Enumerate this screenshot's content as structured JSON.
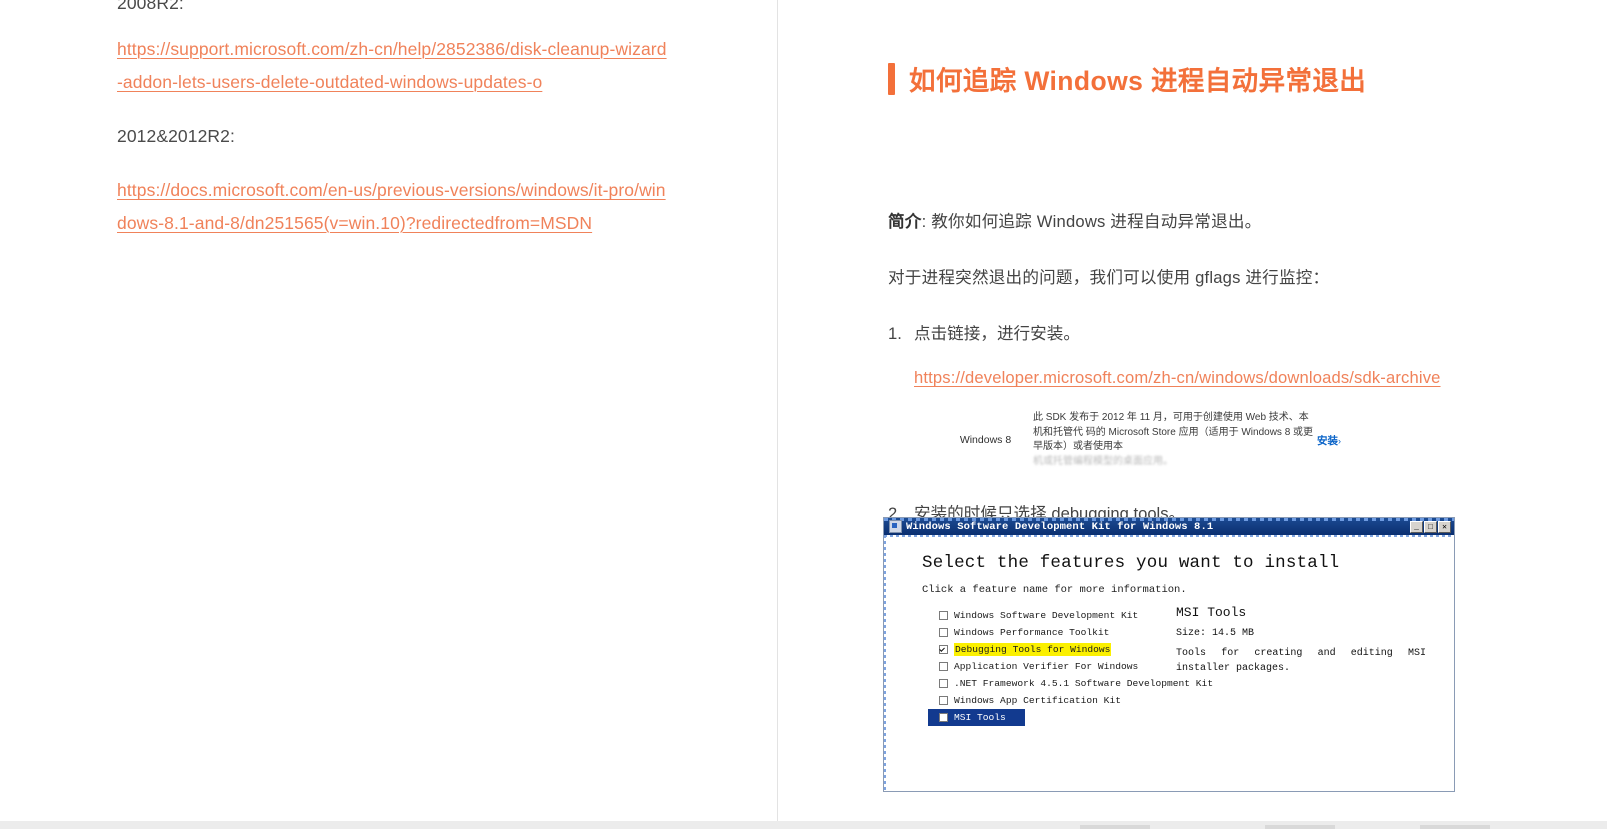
{
  "left_column": {
    "partial_top_text": "2008R2:",
    "link_1": "https://support.microsoft.com/zh-cn/help/2852386/disk-cleanup-wizard-addon-lets-users-delete-outdated-windows-updates-o",
    "label_2012": "2012&2012R2:",
    "link_2": "https://docs.microsoft.com/en-us/previous-versions/windows/it-pro/windows-8.1-and-8/dn251565(v=win.10)?redirectedfrom=MSDN"
  },
  "right_column": {
    "title": "如何追踪 Windows 进程自动异常退出",
    "intro_label": "简介",
    "intro_text": ": 教你如何追踪 Windows 进程自动异常退出。",
    "second_para": "对于进程突然退出的问题，我们可以使用 gflags 进行监控：",
    "steps": [
      {
        "num": "1.",
        "text": "点击链接，进行安装。",
        "link": "https://developer.microsoft.com/zh-cn/windows/downloads/sdk-archive"
      },
      {
        "num": "2.",
        "text": "安装的时候只选择 debugging tools。"
      }
    ],
    "sdk_card": {
      "name": "Windows 8",
      "desc_line1": "此 SDK 发布于 2012 年 11 月，可用于创建使用 Web 技术、本机和托管代",
      "desc_line2": "码的 Microsoft Store 应用（适用于 Windows 8 或更早版本）或者使用本",
      "desc_line3": "机或托管编程模型的桌面应用。",
      "install_label": "安装",
      "install_chevron": "›"
    }
  },
  "installer_window": {
    "title": "Windows Software Development Kit for Windows 8.1",
    "window_buttons": [
      "_",
      "□",
      "✕"
    ],
    "heading": "Select the features you want to install",
    "subheading": "Click a feature name for more information.",
    "features": [
      {
        "label": "Windows Software Development Kit",
        "checked": false,
        "highlighted": false,
        "selected": false
      },
      {
        "label": "Windows Performance Toolkit",
        "checked": false,
        "highlighted": false,
        "selected": false
      },
      {
        "label": "Debugging Tools for Windows",
        "checked": true,
        "highlighted": true,
        "selected": false
      },
      {
        "label": "Application Verifier For Windows",
        "checked": false,
        "highlighted": false,
        "selected": false
      },
      {
        "label": ".NET Framework 4.5.1 Software Development Kit",
        "checked": false,
        "highlighted": false,
        "selected": false
      },
      {
        "label": "Windows App Certification Kit",
        "checked": false,
        "highlighted": false,
        "selected": false
      },
      {
        "label": "MSI Tools",
        "checked": false,
        "highlighted": false,
        "selected": true
      }
    ],
    "detail_panel": {
      "title": "MSI Tools",
      "size": "Size: 14.5 MB",
      "description": "Tools for creating and editing MSI installer packages."
    }
  },
  "colors": {
    "accent_orange": "#f3703a",
    "link_orange": "#f0825a",
    "body_gray": "#444444",
    "titlebar_blue": "#0b2f70",
    "selection_blue": "#123a8f",
    "highlight_yellow": "#fbf000",
    "install_link_blue": "#0b64c8"
  }
}
